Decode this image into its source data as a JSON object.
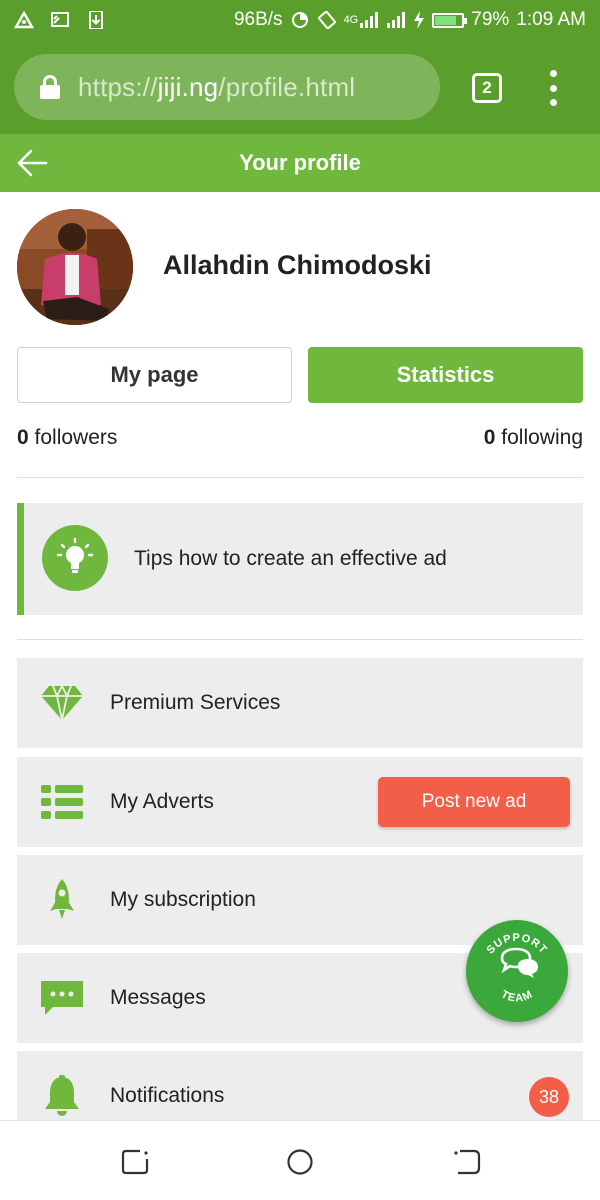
{
  "status_bar": {
    "speed": "96B/s",
    "network": "4G",
    "battery": "79%",
    "battery_level": 0.79,
    "time": "1:09 AM"
  },
  "browser": {
    "url_scheme": "https://",
    "url_host": "jiji.ng",
    "url_path": "/profile.html",
    "tab_count": "2"
  },
  "header": {
    "title": "Your profile"
  },
  "profile": {
    "name": "Allahdin Chimodoski",
    "my_page_label": "My page",
    "statistics_label": "Statistics",
    "followers_count": "0",
    "followers_label": "followers",
    "following_count": "0",
    "following_label": "following"
  },
  "tips": {
    "text": "Tips how to create an effective ad"
  },
  "menu": {
    "items": [
      {
        "label": "Premium Services",
        "icon": "diamond-icon"
      },
      {
        "label": "My Adverts",
        "icon": "list-icon"
      },
      {
        "label": "My subscription",
        "icon": "rocket-icon"
      },
      {
        "label": "Messages",
        "icon": "chat-icon"
      },
      {
        "label": "Notifications",
        "icon": "bell-icon"
      }
    ],
    "post_ad_label": "Post new ad",
    "notifications_badge": "38"
  },
  "support": {
    "top_text": "SUPPORT",
    "bottom_text": "TEAM"
  },
  "colors": {
    "status_bar": "#5a9f2c",
    "title_bar": "#6fb83d",
    "accent_red": "#f35e49",
    "card_bg": "#ededed"
  }
}
